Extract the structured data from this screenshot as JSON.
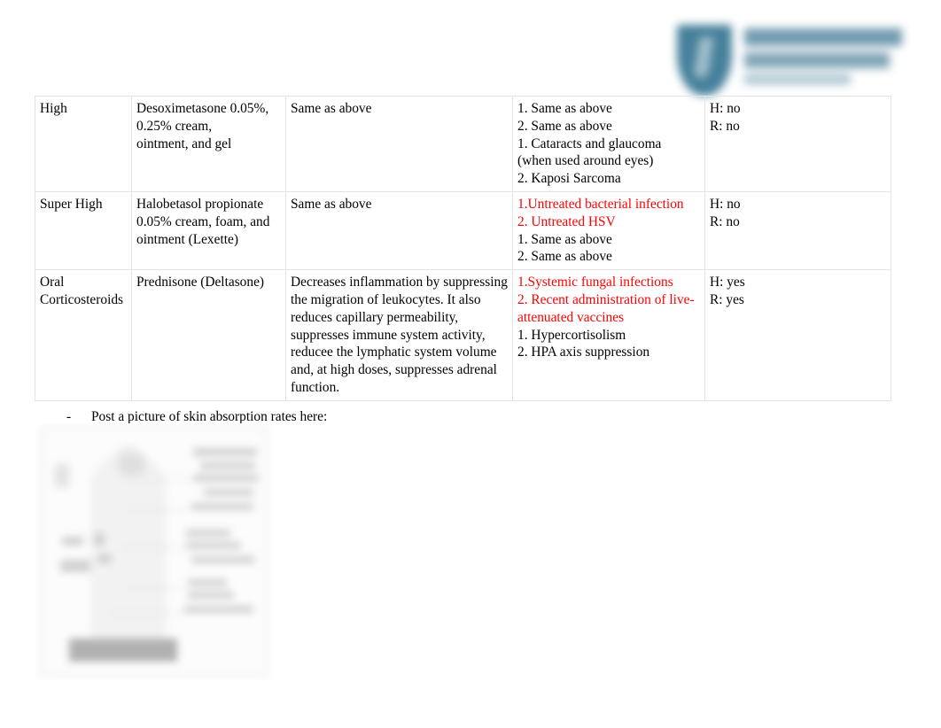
{
  "document": {
    "logo": {
      "icon": "shield-logo-icon",
      "accent_color": "#3d7a96",
      "wordmark_color": "#6b96ab",
      "legible": false
    },
    "highlight_color": "#ff0000",
    "table": {
      "columns": 5,
      "rows": [
        {
          "id": "high",
          "potency": "High",
          "drug": "Desoximetasone 0.05%, 0.25% cream, ointment, and gel",
          "drug_lines": [
            "Desoximetasone 0.05%,",
            "0.25% cream,",
            "ointment, and gel"
          ],
          "mechanism": "Same as above",
          "notes_lines": [
            {
              "text": "1. Same as above",
              "color": "black"
            },
            {
              "text": "2. Same as above",
              "color": "black"
            },
            {
              "text": "1. Cataracts and glaucoma",
              "color": "black"
            },
            {
              "text": "(when used around eyes)",
              "color": "black"
            },
            {
              "text": "2. Kaposi Sarcoma",
              "color": "black"
            }
          ],
          "hepatic": "H: no",
          "renal": "R: no"
        },
        {
          "id": "super-high",
          "potency": "Super High",
          "drug": "Halobetasol propionate 0.05% cream, foam, and ointment (Lexette)",
          "drug_lines": [
            "Halobetasol propionate",
            "0.05% cream, foam, and",
            "ointment (Lexette)"
          ],
          "mechanism": "Same as above",
          "notes_lines": [
            {
              "text": "1.Untreated bacterial infection",
              "color": "red"
            },
            {
              "text": "2. Untreated HSV",
              "color": "red"
            },
            {
              "text": "1. Same as above",
              "color": "black"
            },
            {
              "text": "2. Same as above",
              "color": "black"
            }
          ],
          "hepatic": "H: no",
          "renal": "R: no"
        },
        {
          "id": "oral-corticosteroids",
          "potency": "Oral Corticosteroids",
          "potency_lines": [
            "Oral",
            "Corticosteroids"
          ],
          "drug": "Prednisone (Deltasone)",
          "drug_lines": [
            "Prednisone (Deltasone)"
          ],
          "mechanism": "Decreases inflammation by suppressing the migration of leukocytes. It also reduces capillary permeability, suppresses immune system activity, reducee the lymphatic system volume and, at high doses, suppresses adrenal function.",
          "notes_lines": [
            {
              "text": "1.Systemic fungal infections",
              "color": "red"
            },
            {
              "text": "2. Recent administration of live-attenuated vaccines",
              "color": "red"
            },
            {
              "text": "1. Hypercortisolism",
              "color": "black"
            },
            {
              "text": "2. HPA axis suppression",
              "color": "black"
            }
          ],
          "hepatic": "H: yes",
          "renal": "R: yes"
        }
      ]
    },
    "bullet": {
      "marker": "-",
      "text": "Post a picture of skin absorption rates here:"
    },
    "figure": {
      "name": "skin-absorption-rates-image",
      "legible": false
    }
  }
}
